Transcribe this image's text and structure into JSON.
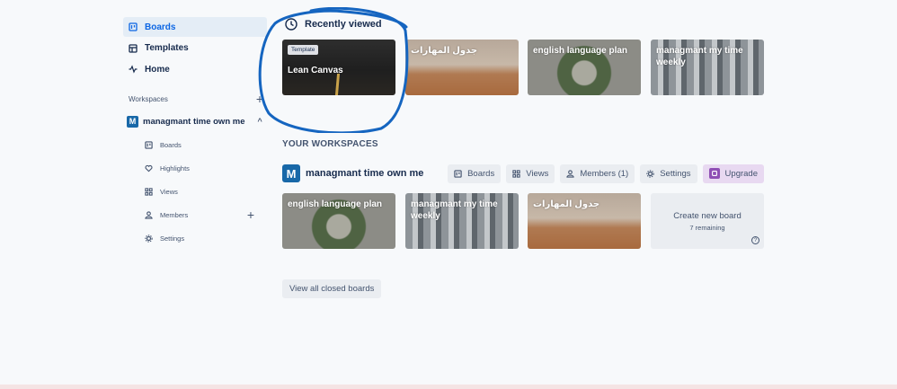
{
  "sidebar": {
    "nav": [
      {
        "label": "Boards",
        "icon": "board-icon"
      },
      {
        "label": "Templates",
        "icon": "template-icon"
      },
      {
        "label": "Home",
        "icon": "pulse-icon"
      }
    ],
    "workspaces_label": "Workspaces",
    "workspace": {
      "badge": "M",
      "name": "managmant time own me"
    },
    "sub_items": [
      {
        "label": "Boards",
        "icon": "board-icon"
      },
      {
        "label": "Highlights",
        "icon": "heart-icon"
      },
      {
        "label": "Views",
        "icon": "grid-icon"
      },
      {
        "label": "Members",
        "icon": "members-icon"
      },
      {
        "label": "Settings",
        "icon": "gear-icon"
      }
    ]
  },
  "recent": {
    "title": "Recently viewed",
    "tiles": [
      {
        "badge": "Template",
        "title": "Lean Canvas"
      },
      {
        "title": "جدول المهارات"
      },
      {
        "title": "english language plan"
      },
      {
        "title": "managmant my time weekly"
      }
    ]
  },
  "workspaces": {
    "section_label": "YOUR WORKSPACES",
    "badge": "M",
    "name": "managmant time own me",
    "buttons": {
      "boards": "Boards",
      "views": "Views",
      "members": "Members (1)",
      "settings": "Settings",
      "upgrade": "Upgrade"
    },
    "tiles": [
      {
        "title": "english language plan"
      },
      {
        "title": "managmant my time weekly"
      },
      {
        "title": "جدول المهارات"
      }
    ],
    "create": {
      "title": "Create new board",
      "remaining": "7 remaining",
      "help": "?"
    }
  },
  "closed_button": "View all closed boards",
  "colors": {
    "accent": "#0c66e4",
    "workspace_badge": "#1868a8",
    "annotation": "#1565c0",
    "upgrade": "#8f4fb5"
  }
}
